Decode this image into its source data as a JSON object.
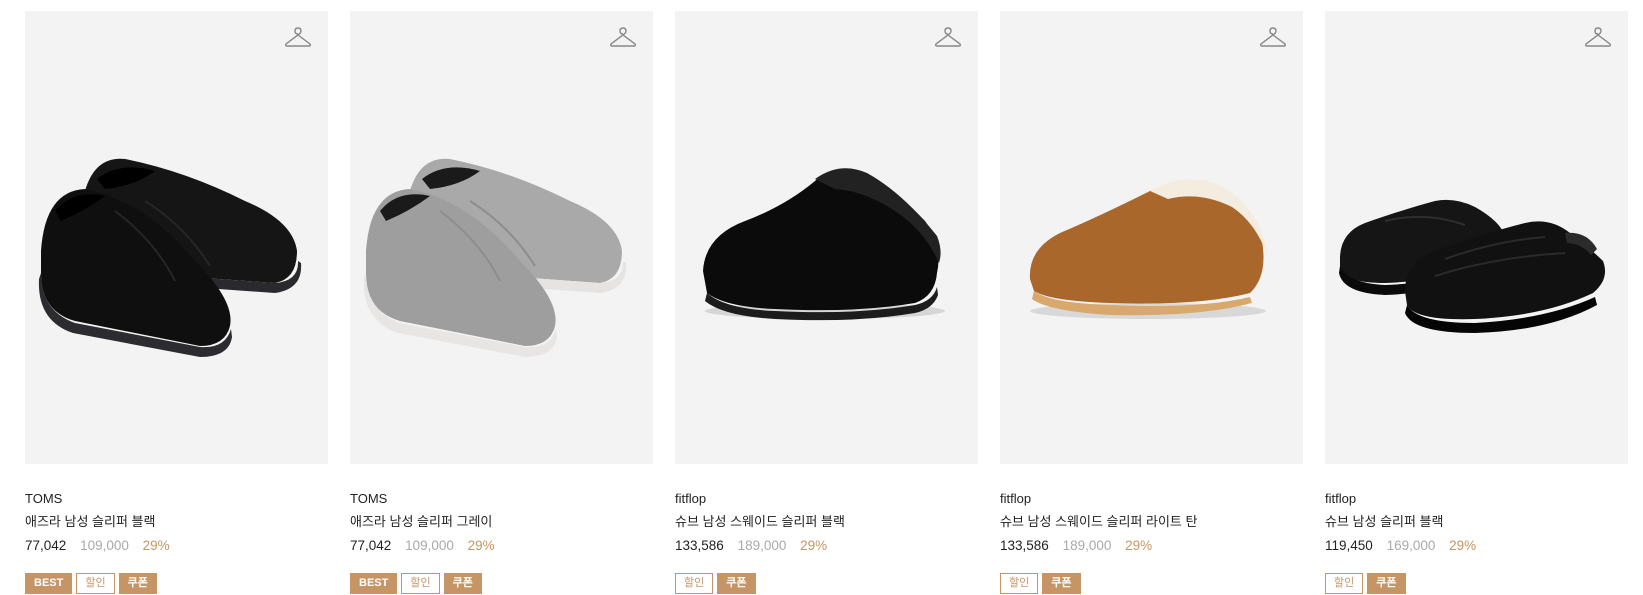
{
  "products": [
    {
      "brand": "TOMS",
      "name": "애즈라 남성 슬리퍼 블랙",
      "price": "77,042",
      "original_price": "109,000",
      "discount": "29%",
      "badges": {
        "best": "BEST",
        "sale": "할인",
        "coupon": "쿠폰"
      },
      "image_icon": "slipper-black-pair",
      "color": "#111111"
    },
    {
      "brand": "TOMS",
      "name": "애즈라 남성 슬리퍼 그레이",
      "price": "77,042",
      "original_price": "109,000",
      "discount": "29%",
      "badges": {
        "best": "BEST",
        "sale": "할인",
        "coupon": "쿠폰"
      },
      "image_icon": "slipper-grey-pair",
      "color": "#a5a5a5"
    },
    {
      "brand": "fitflop",
      "name": "슈브 남성 스웨이드 슬리퍼 블랙",
      "price": "133,586",
      "original_price": "189,000",
      "discount": "29%",
      "badges": {
        "sale": "할인",
        "coupon": "쿠폰"
      },
      "image_icon": "mule-black-single",
      "color": "#0d0d0d"
    },
    {
      "brand": "fitflop",
      "name": "슈브 남성 스웨이드 슬리퍼 라이트 탄",
      "price": "133,586",
      "original_price": "189,000",
      "discount": "29%",
      "badges": {
        "sale": "할인",
        "coupon": "쿠폰"
      },
      "image_icon": "mule-tan-single",
      "color": "#b06f2c"
    },
    {
      "brand": "fitflop",
      "name": "슈브 남성 슬리퍼 블랙",
      "price": "119,450",
      "original_price": "169,000",
      "discount": "29%",
      "badges": {
        "sale": "할인",
        "coupon": "쿠폰"
      },
      "image_icon": "slide-black-pair",
      "color": "#141414"
    }
  ],
  "colors": {
    "accent": "#c59565",
    "thumb_background": "#f3f3f3",
    "muted_text": "#a9a9a9"
  },
  "icons": {
    "wishlist": "hanger-icon"
  }
}
